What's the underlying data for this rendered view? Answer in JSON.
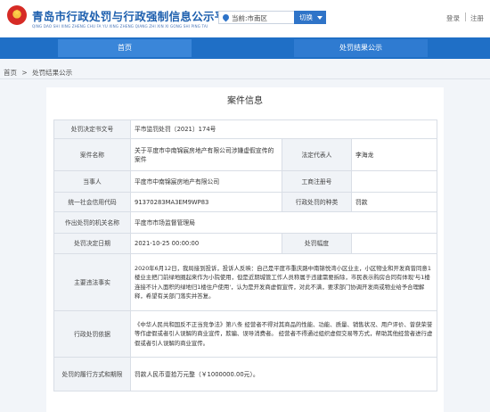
{
  "header": {
    "emblem_glyph": "★",
    "title": "青岛市行政处罚与行政强制信息公示平台",
    "subtitle": "QING DAO SHI XING ZHENG CHU FA YU XING ZHENG QIANG ZHI XIN XI GONG SHI PING TAI",
    "location_text": "当前:市南区",
    "switch_label": "切换",
    "login_label": "登录",
    "register_label": "注册"
  },
  "nav": {
    "tabs": [
      {
        "label": "首页"
      },
      {
        "label": "处罚结果公示"
      }
    ]
  },
  "breadcrumb": {
    "home": "首页",
    "separator": ">",
    "current": "处罚结果公示"
  },
  "case": {
    "panel_title": "案件信息",
    "rows": {
      "decision_no": {
        "label": "处罚决定书文号",
        "value": "平市监罚处罚〔2021〕174号"
      },
      "case_name": {
        "label": "案件名称",
        "value": "关于平度市中南锦宸房地产有限公司涉嫌虚假宣传的案件"
      },
      "legal_rep": {
        "label": "法定代表人",
        "value": "李海龙"
      },
      "party": {
        "label": "当事人",
        "value": "平度市中南锦宸房地产有限公司"
      },
      "license_no": {
        "label": "工商注册号",
        "value": ""
      },
      "credit_code": {
        "label": "统一社会信用代码",
        "value": "91370283MA3EM9WP83"
      },
      "penalty_type": {
        "label": "行政处罚的种类",
        "value": "罚款"
      },
      "authority": {
        "label": "作出处罚的机关名称",
        "value": "平度市市场监督管理局"
      },
      "decision_date": {
        "label": "处罚决定日期",
        "value": "2021-10-25 00:00:00"
      },
      "penalty_range": {
        "label": "处罚幅度",
        "value": ""
      },
      "violation_facts": {
        "label": "主要违法事实",
        "value": "2020年6月12日，我局接到投诉，投诉人反映：自己是平度市重庆路中南锦悦湾小区业主，小区物业和开发商曾同意1楼业主把门前绿地圈起来作为小院使用，但是近期城管工作人员称属于违建需要拆除，市民表示购房合同有体现'与1楼连接不计入面积的绿地归1楼住户使用'，认为是开发商虚假宣传，对此不满，要求部门协调开发商或物业给予合理解释，希望有关部门落实并答复。"
      },
      "basis": {
        "label": "行政处罚依据",
        "value": "《中华人民共和国反不正当竞争法》第八条 经营者不得对其商品的性能、功能、质量、销售状况、用户评价、曾获荣誉等作虚假或者引人误解的商业宣传，欺骗、误导消费者。 经营者不得通过组织虚假交易等方式，帮助其他经营者进行虚假或者引人误解的商业宣传。"
      },
      "method": {
        "label": "处罚的履行方式和期限",
        "value": "罚款人民币壹拾万元整（￥1000000.00元）。"
      }
    }
  },
  "colors": {
    "brand_blue": "#1f6fc6",
    "title_blue": "#1d5fae",
    "page_bg": "#f2f5f9"
  }
}
